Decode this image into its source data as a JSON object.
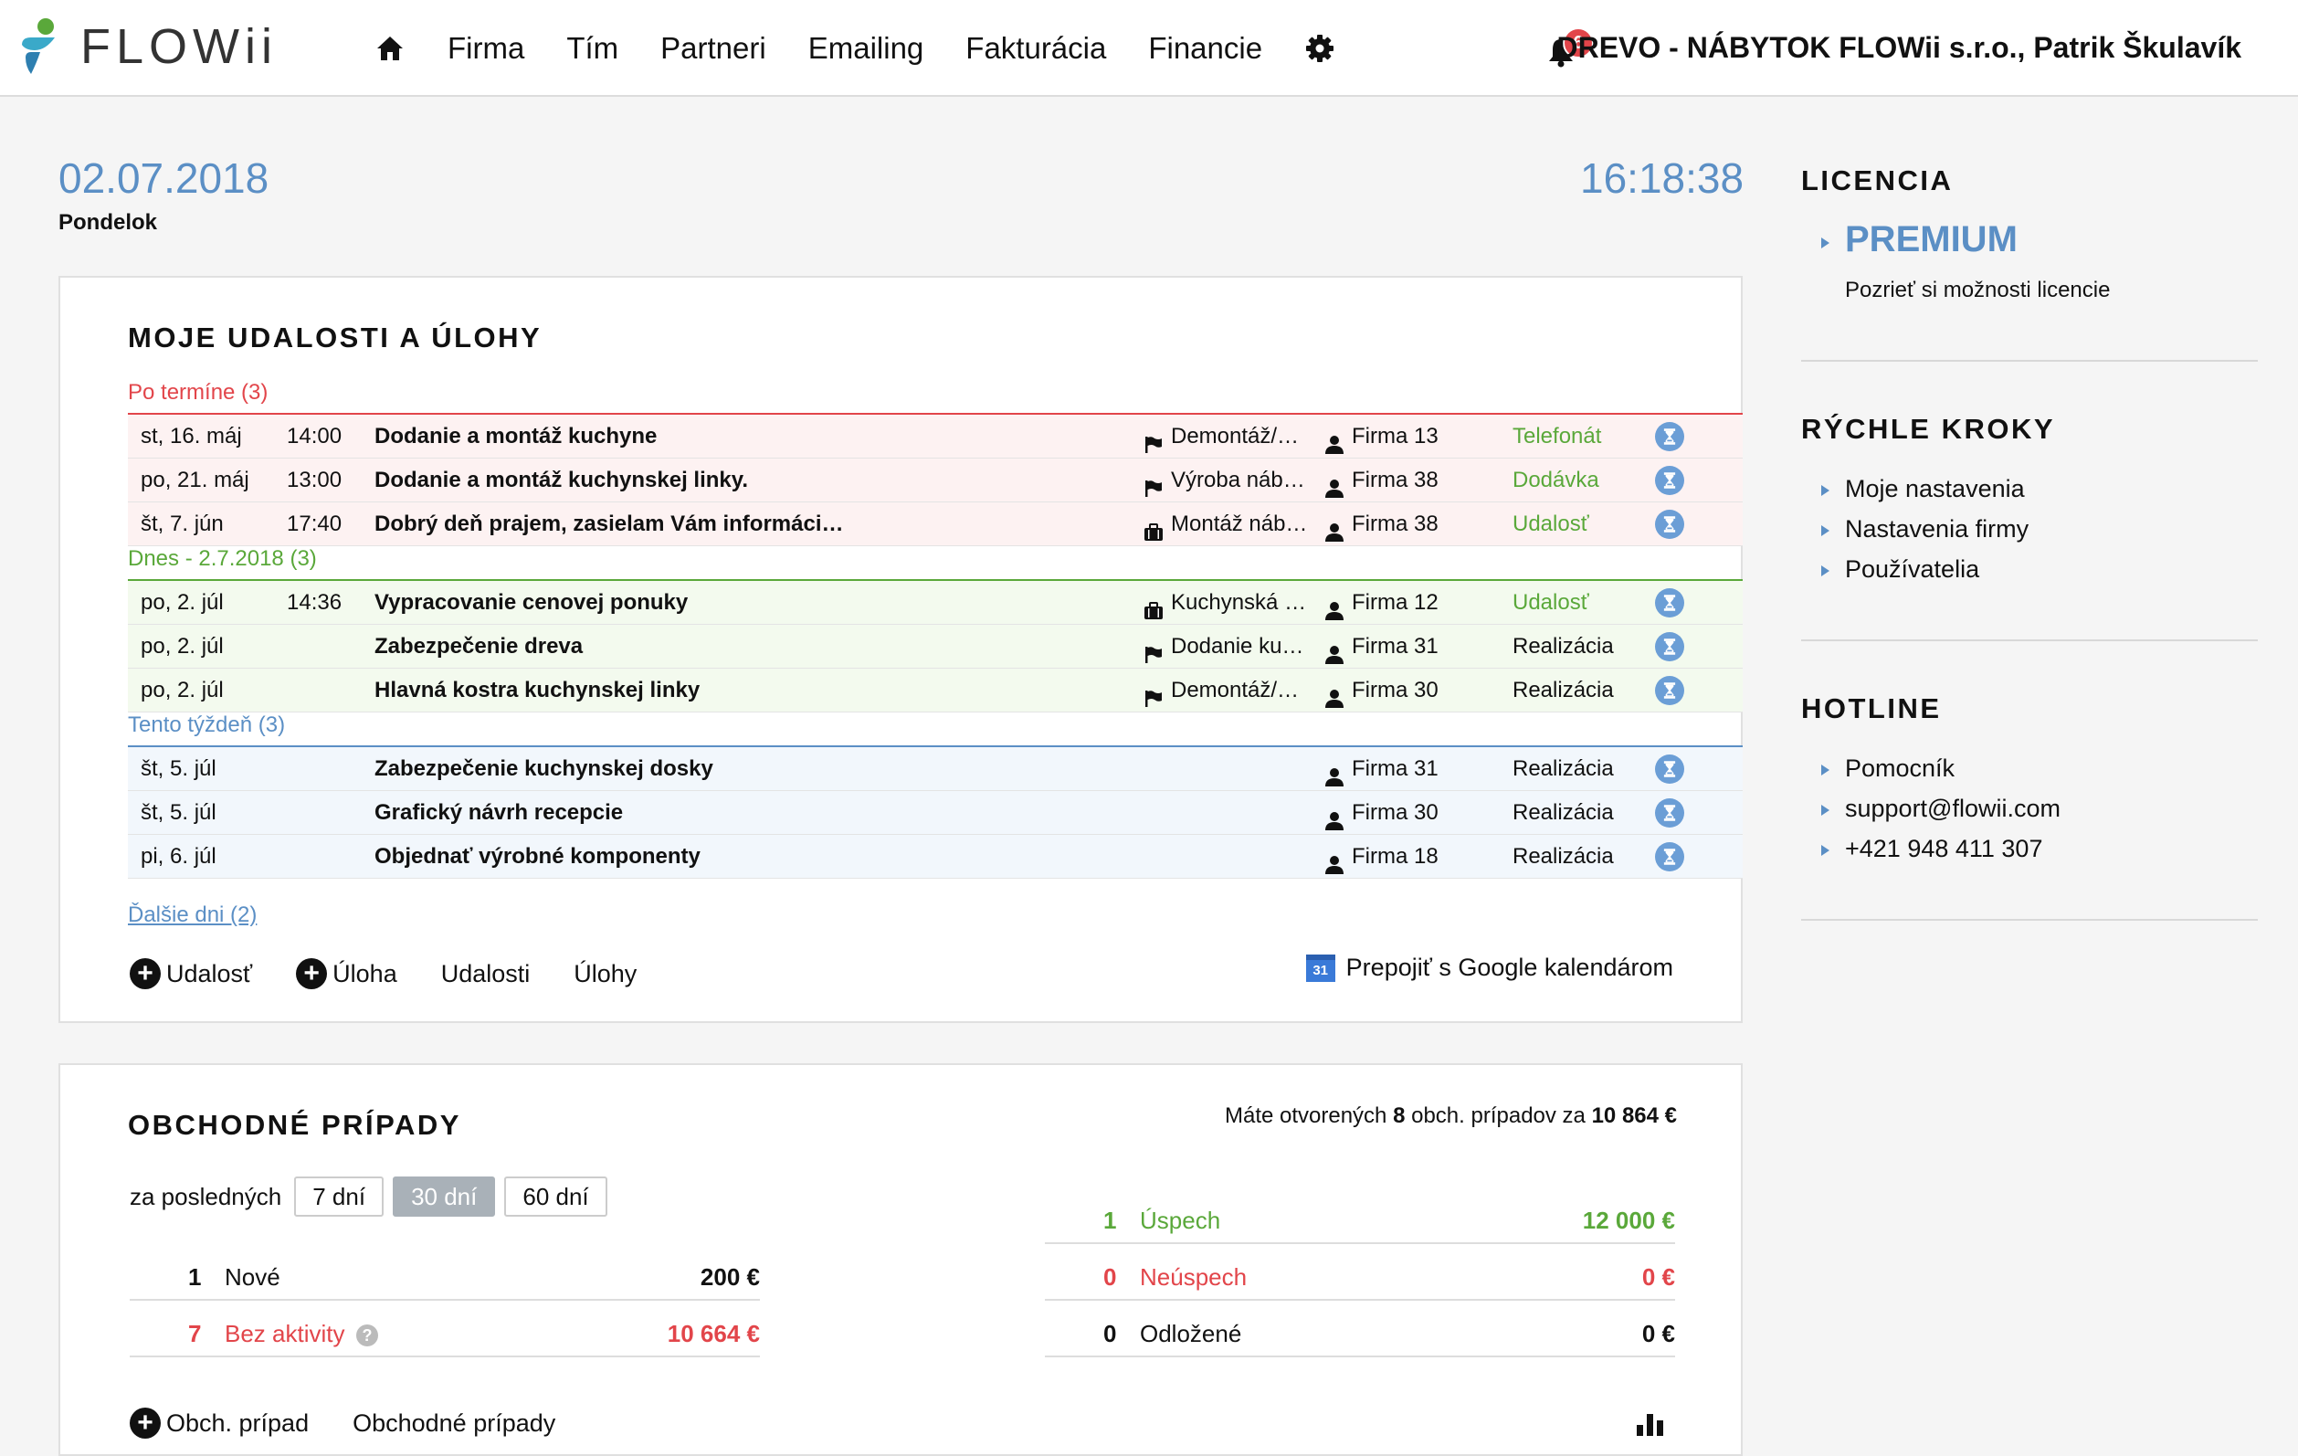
{
  "brand": {
    "name": "FLOWii"
  },
  "nav": {
    "items": [
      "Firma",
      "Tím",
      "Partneri",
      "Emailing",
      "Fakturácia",
      "Financie"
    ]
  },
  "header": {
    "notifications": "6",
    "user": "DREVO - NÁBYTOK FLOWii s.r.o., Patrik Škulavík"
  },
  "today": {
    "date": "02.07.2018",
    "weekday": "Pondelok",
    "time": "16:18:38"
  },
  "events": {
    "title": "MOJE UDALOSTI A ÚLOHY",
    "groups": [
      {
        "label": "Po termíne (3)",
        "color": "#e2454a",
        "bg": "#fdf2f2",
        "rows": [
          {
            "date": "st, 16. máj",
            "time": "14:00",
            "title": "Dodanie a montáž kuchyne",
            "project_icon": "flag-icon",
            "project": "Demontáž/…",
            "firm": "Firma 13",
            "type": "Telefonát",
            "type_color": "#5aa83a"
          },
          {
            "date": "po, 21. máj",
            "time": "13:00",
            "title": "Dodanie a montáž kuchynskej linky.",
            "project_icon": "flag-icon",
            "project": "Výroba náby…",
            "firm": "Firma 38",
            "type": "Dodávka",
            "type_color": "#5aa83a"
          },
          {
            "date": "št, 7. jún",
            "time": "17:40",
            "title": "Dobrý deň prajem, zasielam Vám informáci…",
            "project_icon": "briefcase-icon",
            "project": "Montáž náby…",
            "firm": "Firma 38",
            "type": "Udalosť",
            "type_color": "#5aa83a"
          }
        ]
      },
      {
        "label": "Dnes - 2.7.2018 (3)",
        "color": "#5aa83a",
        "bg": "#f3faee",
        "rows": [
          {
            "date": "po, 2. júl",
            "time": "14:36",
            "title": "Vypracovanie cenovej ponuky",
            "project_icon": "briefcase-icon",
            "project": "Kuchynská li…",
            "firm": "Firma 12",
            "type": "Udalosť",
            "type_color": "#5aa83a"
          },
          {
            "date": "po, 2. júl",
            "time": "",
            "title": "Zabezpečenie dreva",
            "project_icon": "flag-icon",
            "project": "Dodanie kuc…",
            "firm": "Firma 31",
            "type": "Realizácia",
            "type_color": "#111111"
          },
          {
            "date": "po, 2. júl",
            "time": "",
            "title": "Hlavná kostra kuchynskej linky",
            "project_icon": "flag-icon",
            "project": "Demontáž/…",
            "firm": "Firma 30",
            "type": "Realizácia",
            "type_color": "#111111"
          }
        ]
      },
      {
        "label": "Tento týždeň (3)",
        "color": "#5b8fc5",
        "bg": "#f2f7fc",
        "rows": [
          {
            "date": "št, 5. júl",
            "time": "",
            "title": "Zabezpečenie kuchynskej dosky",
            "project_icon": "",
            "project": "",
            "firm": "Firma 31",
            "type": "Realizácia",
            "type_color": "#111111"
          },
          {
            "date": "št, 5. júl",
            "time": "",
            "title": "Grafický návrh recepcie",
            "project_icon": "",
            "project": "",
            "firm": "Firma 30",
            "type": "Realizácia",
            "type_color": "#111111"
          },
          {
            "date": "pi, 6. júl",
            "time": "",
            "title": "Objednať výrobné komponenty",
            "project_icon": "",
            "project": "",
            "firm": "Firma 18",
            "type": "Realizácia",
            "type_color": "#111111"
          }
        ]
      }
    ],
    "more_label": "Ďalšie dni (2)",
    "actions": {
      "add_event": "Udalosť",
      "add_task": "Úloha",
      "events_link": "Udalosti",
      "tasks_link": "Úlohy"
    },
    "google_icon_text": "31",
    "google": "Prepojiť s Google kalendárom"
  },
  "deals": {
    "title": "OBCHODNÉ PRÍPADY",
    "summary": {
      "prefix": "Máte otvorených",
      "count": "8",
      "middle": "obch. prípadov za",
      "amount": "10 864 €"
    },
    "period_label": "za posledných",
    "periods": [
      "7 dní",
      "30 dní",
      "60 dní"
    ],
    "left_stats": [
      {
        "num": "1",
        "label": "Nové",
        "value": "200 €",
        "color": "#111111"
      },
      {
        "num": "7",
        "label": "Bez aktivity",
        "value": "10 664 €",
        "color": "#e2454a"
      }
    ],
    "right_stats": [
      {
        "num": "1",
        "label": "Úspech",
        "value": "12 000 €",
        "color": "#5aa83a"
      },
      {
        "num": "0",
        "label": "Neúspech",
        "value": "0 €",
        "color": "#e2454a"
      },
      {
        "num": "0",
        "label": "Odložené",
        "value": "0 €",
        "color": "#111111"
      }
    ],
    "actions": {
      "add": "Obch. prípad",
      "list": "Obchodné prípady"
    }
  },
  "sidebar": {
    "license": {
      "title": "LICENCIA",
      "plan": "PREMIUM",
      "link": "Pozrieť si možnosti licencie"
    },
    "quick": {
      "title": "RÝCHLE KROKY",
      "items": [
        "Moje nastavenia",
        "Nastavenia firmy",
        "Používatelia"
      ]
    },
    "hotline": {
      "title": "HOTLINE",
      "items": [
        "Pomocník",
        "support@flowii.com",
        "+421 948 411 307"
      ]
    }
  },
  "colors": {
    "accent": "#5b8fc5",
    "danger": "#e2454a",
    "success": "#5aa83a"
  }
}
